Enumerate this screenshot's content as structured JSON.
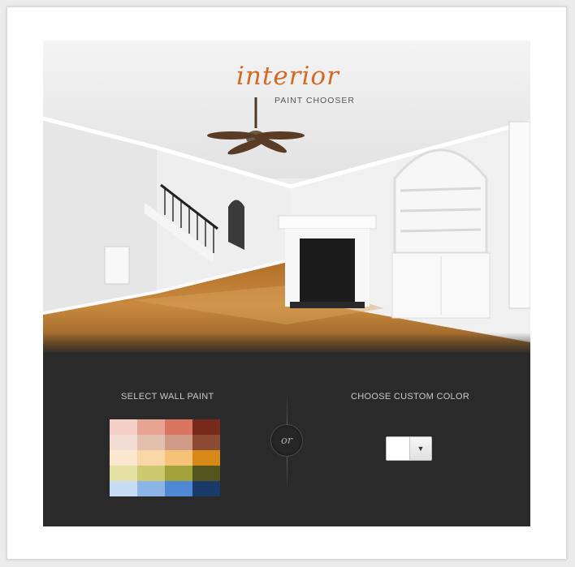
{
  "header": {
    "logo_text": "interior",
    "subtitle": "PAINT CHOOSER"
  },
  "wall_paint": {
    "title": "SELECT WALL PAINT",
    "swatches": [
      "#f3cfc5",
      "#e8a492",
      "#d97560",
      "#772a1c",
      "#f1ddd3",
      "#e3bfae",
      "#cf9b86",
      "#8c4a34",
      "#fbe7cf",
      "#f9d7a8",
      "#f6c277",
      "#d78918",
      "#e5e0a4",
      "#ccc971",
      "#a3a23a",
      "#54551d",
      "#c7dbf4",
      "#8cb4e6",
      "#4f88d4",
      "#1a3b6a"
    ]
  },
  "separator": {
    "label": "or"
  },
  "custom_color": {
    "title": "CHOOSE CUSTOM COLOR",
    "value": "#ffffff",
    "arrow": "▼"
  }
}
